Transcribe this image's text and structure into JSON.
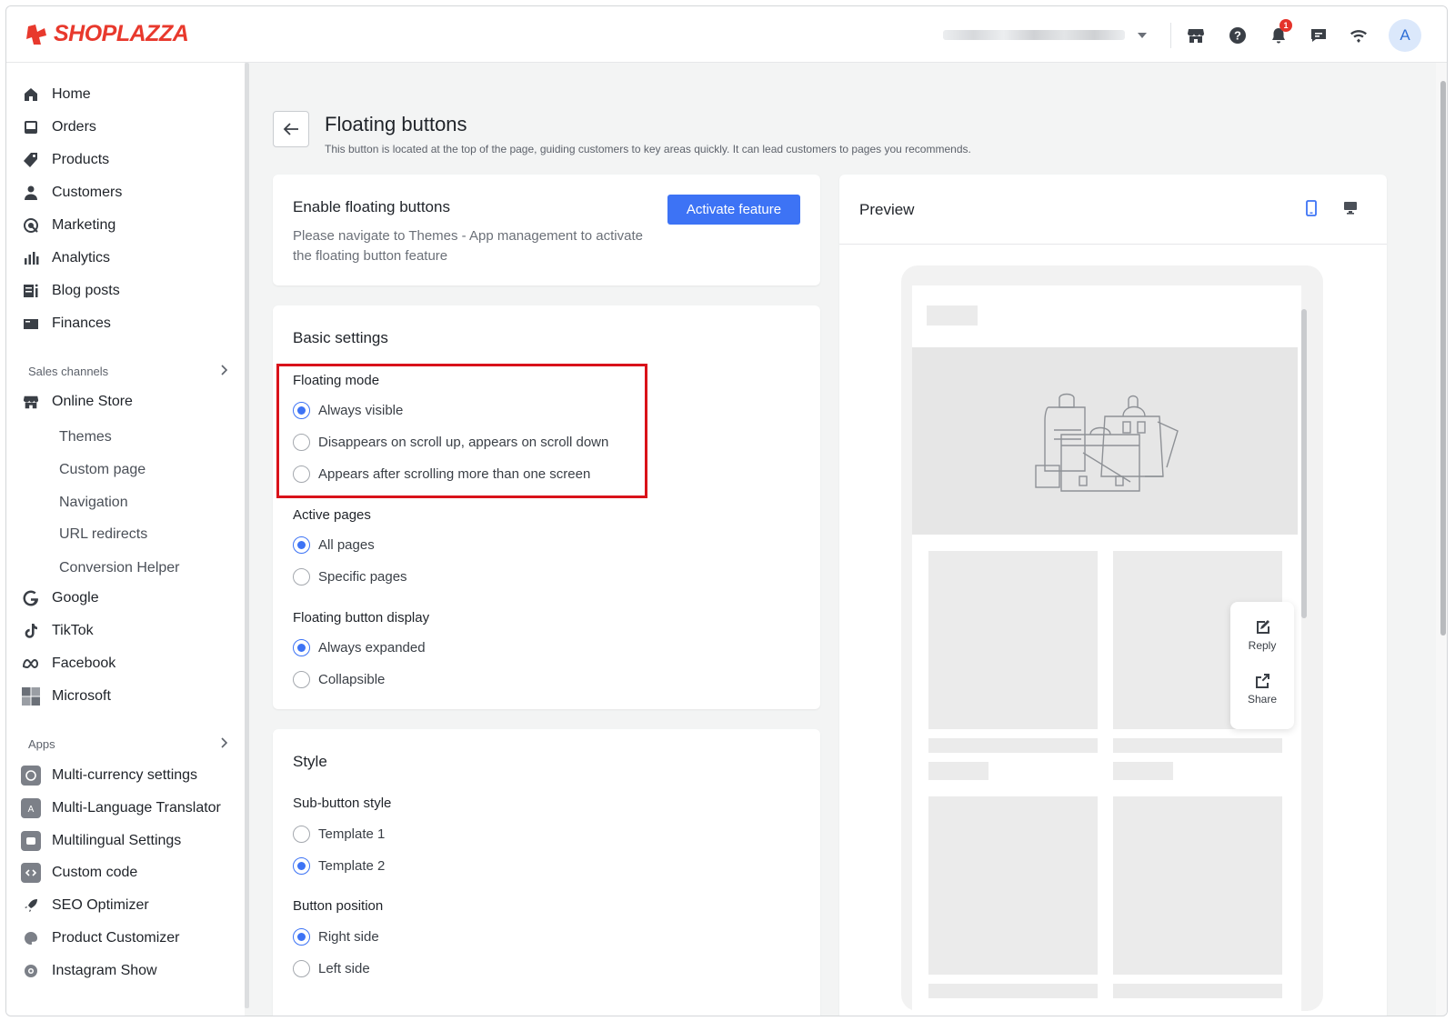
{
  "brand": {
    "name": "SHOPLAZZA",
    "color": "#e8392d"
  },
  "topbar": {
    "icons": [
      "storefront-icon",
      "help-icon",
      "bell-icon",
      "chat-icon",
      "wifi-icon"
    ],
    "notification_count": "1",
    "avatar_letter": "A"
  },
  "sidebar": {
    "main_items": [
      {
        "label": "Home",
        "icon": "home-icon"
      },
      {
        "label": "Orders",
        "icon": "orders-icon"
      },
      {
        "label": "Products",
        "icon": "tag-icon"
      },
      {
        "label": "Customers",
        "icon": "person-icon"
      },
      {
        "label": "Marketing",
        "icon": "target-icon"
      },
      {
        "label": "Analytics",
        "icon": "bar-chart-icon"
      },
      {
        "label": "Blog posts",
        "icon": "blog-icon"
      },
      {
        "label": "Finances",
        "icon": "wallet-icon"
      }
    ],
    "sales_channels_label": "Sales channels",
    "online_store": "Online Store",
    "online_store_sub": [
      "Themes",
      "Custom page",
      "Navigation",
      "URL redirects",
      "Conversion Helper"
    ],
    "channels": [
      {
        "label": "Google",
        "icon": "google-icon"
      },
      {
        "label": "TikTok",
        "icon": "tiktok-icon"
      },
      {
        "label": "Facebook",
        "icon": "meta-icon"
      },
      {
        "label": "Microsoft",
        "icon": "microsoft-icon"
      }
    ],
    "apps_label": "Apps",
    "apps": [
      {
        "label": "Multi-currency settings",
        "icon": "currency-icon"
      },
      {
        "label": "Multi-Language Translator",
        "icon": "translate-icon"
      },
      {
        "label": "Multilingual Settings",
        "icon": "language-icon"
      },
      {
        "label": "Custom code",
        "icon": "code-icon"
      },
      {
        "label": "SEO Optimizer",
        "icon": "rocket-icon"
      },
      {
        "label": "Product Customizer",
        "icon": "palette-icon"
      },
      {
        "label": "Instagram Show",
        "icon": "instagram-icon"
      }
    ]
  },
  "page": {
    "title": "Floating buttons",
    "description": "This button is located at the top of the page, guiding customers to key areas quickly. It can lead customers to pages you recommends."
  },
  "enable_card": {
    "title": "Enable floating buttons",
    "text": "Please navigate to Themes - App management to activate the floating button feature",
    "button": "Activate feature"
  },
  "basic_settings": {
    "title": "Basic settings",
    "floating_mode": {
      "label": "Floating mode",
      "options": [
        "Always visible",
        "Disappears on scroll up, appears on scroll down",
        "Appears after scrolling more than one screen"
      ],
      "selected": 0
    },
    "active_pages": {
      "label": "Active pages",
      "options": [
        "All pages",
        "Specific pages"
      ],
      "selected": 0
    },
    "display": {
      "label": "Floating button display",
      "options": [
        "Always expanded",
        "Collapsible"
      ],
      "selected": 0
    }
  },
  "style": {
    "title": "Style",
    "sub_button_style": {
      "label": "Sub-button style",
      "options": [
        "Template 1",
        "Template 2"
      ],
      "selected": 1
    },
    "button_position": {
      "label": "Button position",
      "options": [
        "Right side",
        "Left side"
      ],
      "selected": 0
    }
  },
  "preview": {
    "title": "Preview",
    "reply": "Reply",
    "share": "Share"
  },
  "colors": {
    "accent": "#3d73f5",
    "highlight": "#d9121a"
  }
}
